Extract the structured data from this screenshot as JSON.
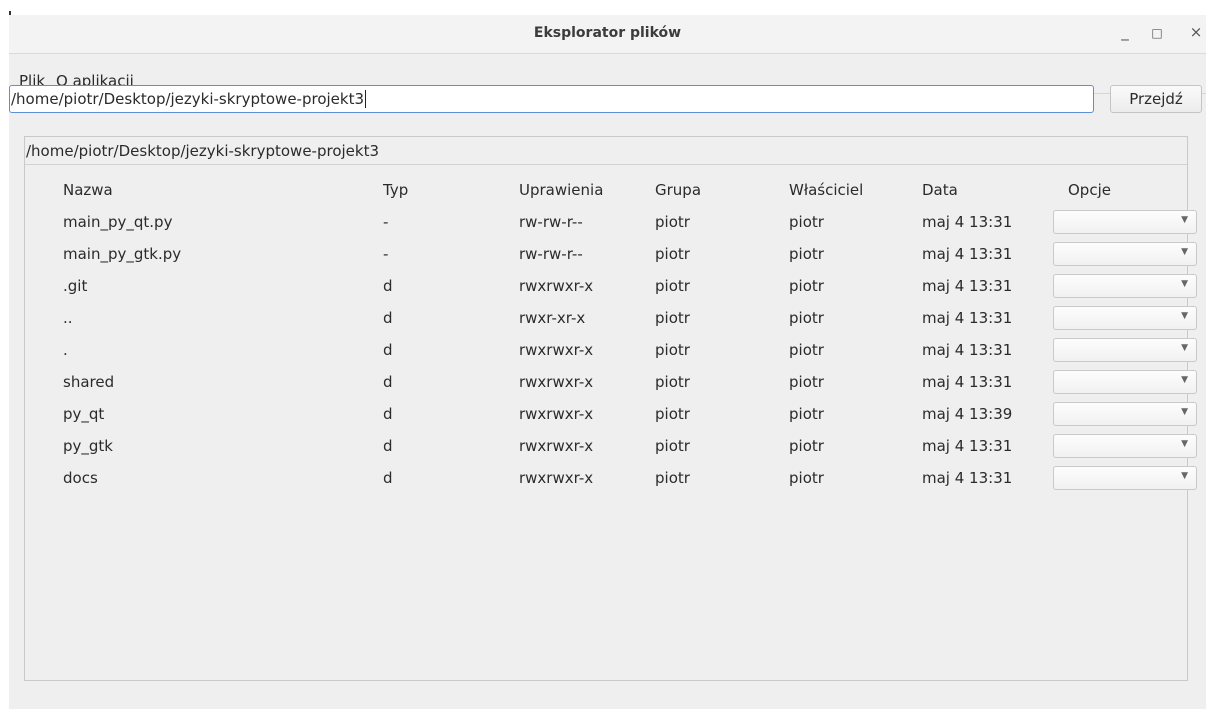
{
  "window": {
    "title": "Eksplorator plików",
    "controls": {
      "minimize": "_",
      "maximize": "□",
      "close": "×"
    }
  },
  "menu": {
    "file": "Plik",
    "about": "O aplikacji"
  },
  "path_bar": {
    "value": "/home/piotr/Desktop/jezyki-skryptowe-projekt3",
    "go_label": "Przejdź"
  },
  "listing": {
    "title": "/home/piotr/Desktop/jezyki-skryptowe-projekt3",
    "columns": {
      "name": "Nazwa",
      "type": "Typ",
      "permissions": "Uprawienia",
      "group": "Grupa",
      "owner": "Właściciel",
      "date": "Data",
      "options": "Opcje"
    },
    "rows": [
      {
        "name": "main_py_qt.py",
        "type": "-",
        "permissions": "rw-rw-r--",
        "group": "piotr",
        "owner": "piotr",
        "date": "maj  4 13:31",
        "option": ""
      },
      {
        "name": "main_py_gtk.py",
        "type": "-",
        "permissions": "rw-rw-r--",
        "group": "piotr",
        "owner": "piotr",
        "date": "maj  4 13:31",
        "option": ""
      },
      {
        "name": ".git",
        "type": "d",
        "permissions": "rwxrwxr-x",
        "group": "piotr",
        "owner": "piotr",
        "date": "maj  4 13:31",
        "option": ""
      },
      {
        "name": "..",
        "type": "d",
        "permissions": "rwxr-xr-x",
        "group": "piotr",
        "owner": "piotr",
        "date": "maj  4 13:31",
        "option": ""
      },
      {
        "name": ".",
        "type": "d",
        "permissions": "rwxrwxr-x",
        "group": "piotr",
        "owner": "piotr",
        "date": "maj  4 13:31",
        "option": ""
      },
      {
        "name": "shared",
        "type": "d",
        "permissions": "rwxrwxr-x",
        "group": "piotr",
        "owner": "piotr",
        "date": "maj  4 13:31",
        "option": ""
      },
      {
        "name": "py_qt",
        "type": "d",
        "permissions": "rwxrwxr-x",
        "group": "piotr",
        "owner": "piotr",
        "date": "maj  4 13:39",
        "option": ""
      },
      {
        "name": "py_gtk",
        "type": "d",
        "permissions": "rwxrwxr-x",
        "group": "piotr",
        "owner": "piotr",
        "date": "maj  4 13:31",
        "option": ""
      },
      {
        "name": "docs",
        "type": "d",
        "permissions": "rwxrwxr-x",
        "group": "piotr",
        "owner": "piotr",
        "date": "maj  4 13:31",
        "option": ""
      }
    ]
  },
  "colors": {
    "focus_border": "#5b8fd6",
    "window_bg": "#efefef"
  },
  "icons": {
    "dropdown": "chevron-down-icon"
  }
}
